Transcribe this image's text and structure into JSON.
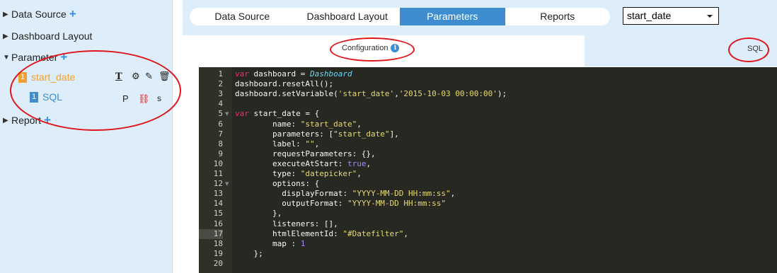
{
  "sidebar": {
    "data_source": "Data Source",
    "dashboard_layout": "Dashboard Layout",
    "parameter": "Parameter",
    "report": "Report",
    "param_item": {
      "badge": "1",
      "label": "start_date"
    },
    "sql_item": {
      "badge": "1",
      "label": "SQL"
    },
    "sql_tools": {
      "p": "P",
      "s": "S"
    },
    "colors": {
      "plus": "#3a8fd8",
      "param_badge": "#f0a030",
      "sql_badge": "#3d8dd0"
    }
  },
  "tabs": [
    "Data Source",
    "Dashboard Layout",
    "Parameters",
    "Reports"
  ],
  "active_tab": "Parameters",
  "param_select": "start_date",
  "subtabs": {
    "configuration": "Configuration",
    "sql": "SQL"
  },
  "editor": {
    "active_line": 17,
    "lines": [
      {
        "n": "1",
        "code": "var dashboard = Dashboard"
      },
      {
        "n": "2",
        "code": "dashboard.resetAll();"
      },
      {
        "n": "3",
        "code": "dashboard.setVariable('start_date','2015-10-03 00:00:00');"
      },
      {
        "n": "4",
        "code": ""
      },
      {
        "n": "5",
        "code": "var start_date = {"
      },
      {
        "n": "6",
        "code": "        name: \"start_date\","
      },
      {
        "n": "7",
        "code": "        parameters: [\"start_date\"],"
      },
      {
        "n": "8",
        "code": "        label: \"\","
      },
      {
        "n": "9",
        "code": "        requestParameters: {},"
      },
      {
        "n": "10",
        "code": "        executeAtStart: true,"
      },
      {
        "n": "11",
        "code": "        type: \"datepicker\","
      },
      {
        "n": "12",
        "code": "        options: {"
      },
      {
        "n": "13",
        "code": "          displayFormat: \"YYYY-MM-DD HH:mm:ss\","
      },
      {
        "n": "14",
        "code": "          outputFormat: \"YYYY-MM-DD HH:mm:ss\""
      },
      {
        "n": "15",
        "code": "        },"
      },
      {
        "n": "16",
        "code": "        listeners: [],"
      },
      {
        "n": "17",
        "code": "        htmlElementId: \"#Datefilter\","
      },
      {
        "n": "18",
        "code": "        map : 1"
      },
      {
        "n": "19",
        "code": "    };"
      },
      {
        "n": "20",
        "code": ""
      }
    ]
  }
}
